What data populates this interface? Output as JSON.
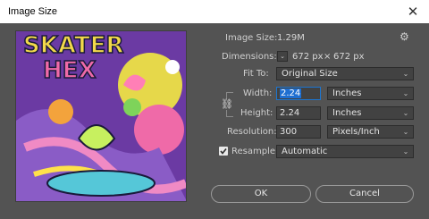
{
  "window": {
    "title": "Image Size"
  },
  "image_size": {
    "label": "Image Size:",
    "value": "1.29M"
  },
  "dimensions": {
    "label": "Dimensions:",
    "width": "672 px",
    "times": "×",
    "height": "672 px"
  },
  "fit_to": {
    "label": "Fit To:",
    "value": "Original Size"
  },
  "width": {
    "label": "Width:",
    "value": "2.24",
    "unit": "Inches"
  },
  "height": {
    "label": "Height:",
    "value": "2.24",
    "unit": "Inches"
  },
  "resolution": {
    "label": "Resolution:",
    "value": "300",
    "unit": "Pixels/Inch"
  },
  "resample": {
    "label": "Resample:",
    "value": "Automatic",
    "checked": true
  },
  "buttons": {
    "ok": "OK",
    "cancel": "Cancel"
  },
  "icons": {
    "close": "close-icon",
    "gear": "gear-icon",
    "chevron": "chevron-down-icon",
    "link": "chain-link-icon",
    "dimensions_toggle": "chevron-down-icon"
  },
  "colors": {
    "background": "#535353",
    "field": "#424242",
    "accent": "#1f6fd1",
    "titlebar": "#ffffff"
  },
  "preview_text": "SKATER HEX"
}
